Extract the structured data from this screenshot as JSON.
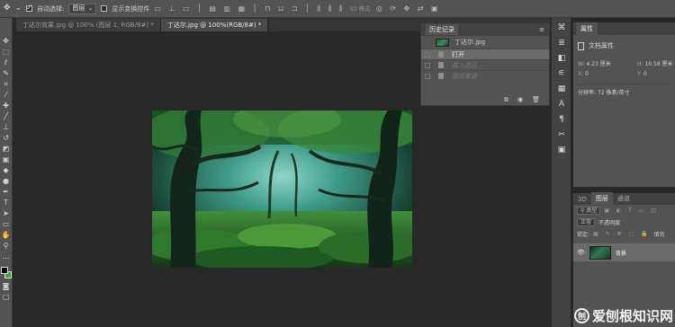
{
  "options_bar": {
    "auto_select_label": "自动选择:",
    "auto_select_value": "图层",
    "show_transform_label": "显示变换控件",
    "mode_3d_label": "3D 模式:"
  },
  "tabs": [
    {
      "label": "丁达尔效果.jpg @ 100% (图层 1, RGB/8#) *"
    },
    {
      "label": "丁达尔.jpg @ 100%(RGB/8#) *"
    }
  ],
  "history": {
    "title": "历史记录",
    "snapshot_name": "丁达尔.jpg",
    "rows": [
      "打开",
      "载入选区",
      "图层蒙版"
    ]
  },
  "properties": {
    "title": "属性",
    "doc_label": "文档属性",
    "w_label": "W:",
    "w_value": "4.23 厘米",
    "h_label": "H:",
    "h_value": "10.58 厘米",
    "x_label": "X:",
    "x_value": "0",
    "y_label": "Y:",
    "y_value": "0",
    "resolution": "分辨率: 72 像素/英寸"
  },
  "layers": {
    "tabs": [
      "3D",
      "图层",
      "通道"
    ],
    "kind_label": "类型",
    "blend_mode": "正常",
    "opacity": "不透明度",
    "lock_label": "锁定:",
    "fill_label": "填充",
    "layer_name": "背景"
  },
  "watermark": "爱刨根知识网",
  "colors": {
    "foreground": "#000000",
    "background": "#27b227"
  }
}
